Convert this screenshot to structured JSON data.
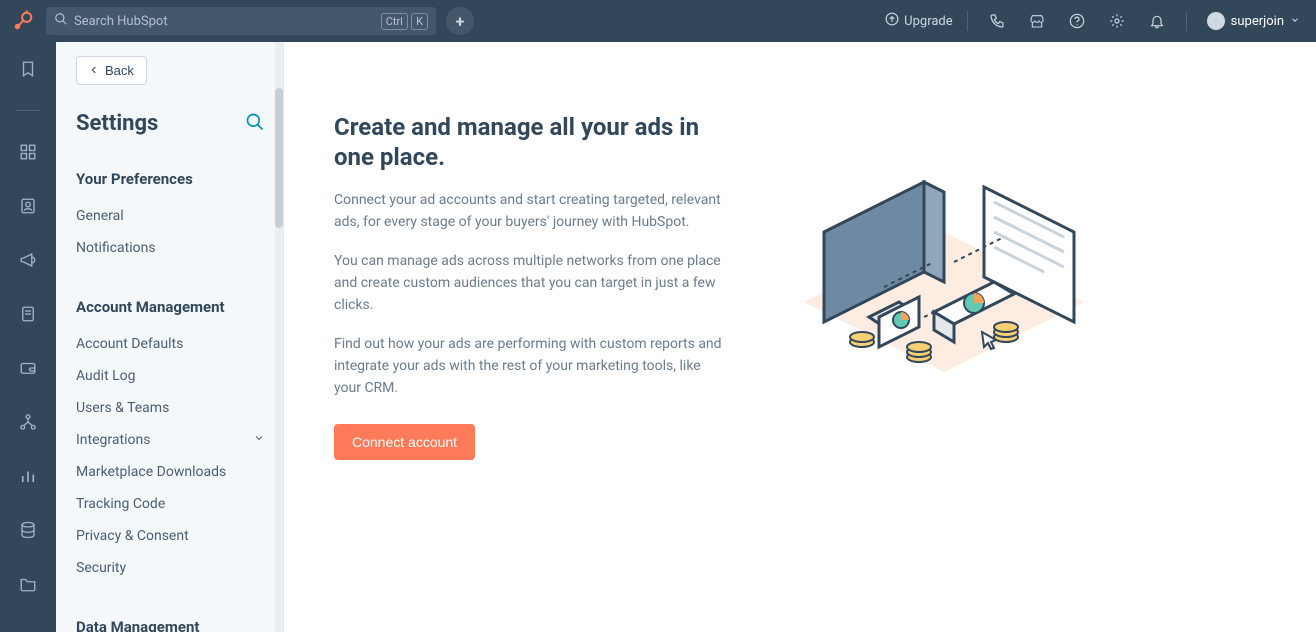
{
  "topbar": {
    "search_placeholder": "Search HubSpot",
    "ctrl": "Ctrl",
    "k": "K",
    "upgrade_label": "Upgrade",
    "user_label": "superjoin"
  },
  "sidebar": {
    "back_label": "Back",
    "title": "Settings",
    "sections": [
      {
        "title": "Your Preferences",
        "items": [
          {
            "label": "General",
            "expandable": false
          },
          {
            "label": "Notifications",
            "expandable": false
          }
        ]
      },
      {
        "title": "Account Management",
        "items": [
          {
            "label": "Account Defaults",
            "expandable": false
          },
          {
            "label": "Audit Log",
            "expandable": false
          },
          {
            "label": "Users & Teams",
            "expandable": false
          },
          {
            "label": "Integrations",
            "expandable": true
          },
          {
            "label": "Marketplace Downloads",
            "expandable": false
          },
          {
            "label": "Tracking Code",
            "expandable": false
          },
          {
            "label": "Privacy & Consent",
            "expandable": false
          },
          {
            "label": "Security",
            "expandable": false
          }
        ]
      },
      {
        "title": "Data Management",
        "items": []
      }
    ]
  },
  "main": {
    "heading": "Create and manage all your ads in one place.",
    "p1": "Connect your ad accounts and start creating targeted, relevant ads, for every stage of your buyers' journey with HubSpot.",
    "p2": "You can manage ads across multiple networks from one place and create custom audiences that you can target in just a few clicks.",
    "p3": "Find out how your ads are performing with custom reports and integrate your ads with the rest of your marketing tools, like your CRM.",
    "cta_label": "Connect account"
  }
}
